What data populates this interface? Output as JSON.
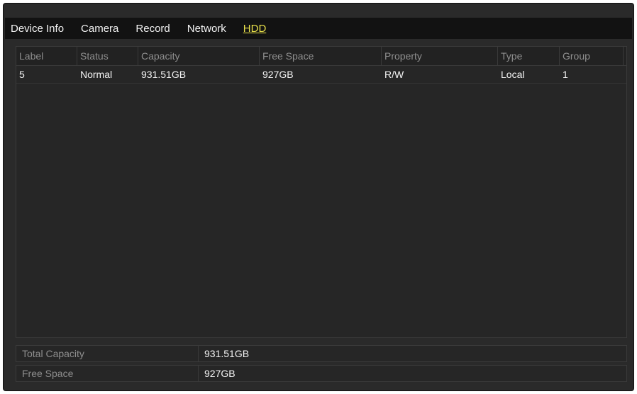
{
  "tabs": [
    {
      "label": "Device Info"
    },
    {
      "label": "Camera"
    },
    {
      "label": "Record"
    },
    {
      "label": "Network"
    },
    {
      "label": "HDD",
      "active": true
    }
  ],
  "table": {
    "columns": [
      "Label",
      "Status",
      "Capacity",
      "Free Space",
      "Property",
      "Type",
      "Group"
    ],
    "rows": [
      [
        "5",
        "Normal",
        "931.51GB",
        "927GB",
        "R/W",
        "Local",
        "1"
      ]
    ]
  },
  "summary": {
    "total_capacity_label": "Total Capacity",
    "total_capacity_value": "931.51GB",
    "free_space_label": "Free Space",
    "free_space_value": "927GB"
  },
  "colors": {
    "active_tab": "#e8e04a",
    "background": "#2a2a2a"
  }
}
